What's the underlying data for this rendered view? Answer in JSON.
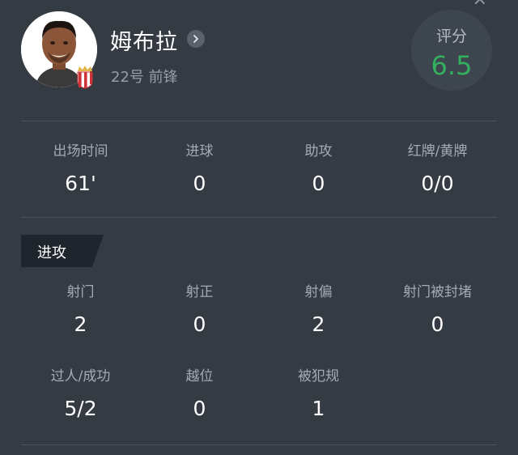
{
  "player": {
    "name": "姆布拉",
    "meta": "22号 前锋",
    "rating_label": "评分",
    "rating": "6.5"
  },
  "colors": {
    "background": "#343b43",
    "rating_green": "#33b05e",
    "section_tag_bg": "#1f252c"
  },
  "summary_stats": [
    {
      "label": "出场时间",
      "value": "61'"
    },
    {
      "label": "进球",
      "value": "0"
    },
    {
      "label": "助攻",
      "value": "0"
    },
    {
      "label": "红牌/黄牌",
      "value": "0/0"
    }
  ],
  "attack": {
    "title": "进攻",
    "row1": [
      {
        "label": "射门",
        "value": "2"
      },
      {
        "label": "射正",
        "value": "0"
      },
      {
        "label": "射偏",
        "value": "2"
      },
      {
        "label": "射门被封堵",
        "value": "0"
      }
    ],
    "row2": [
      {
        "label": "过人/成功",
        "value": "5/2"
      },
      {
        "label": "越位",
        "value": "0"
      },
      {
        "label": "被犯规",
        "value": "1"
      }
    ]
  },
  "icons": [
    "close-icon",
    "chevron-right-icon",
    "club-badge-icon"
  ]
}
